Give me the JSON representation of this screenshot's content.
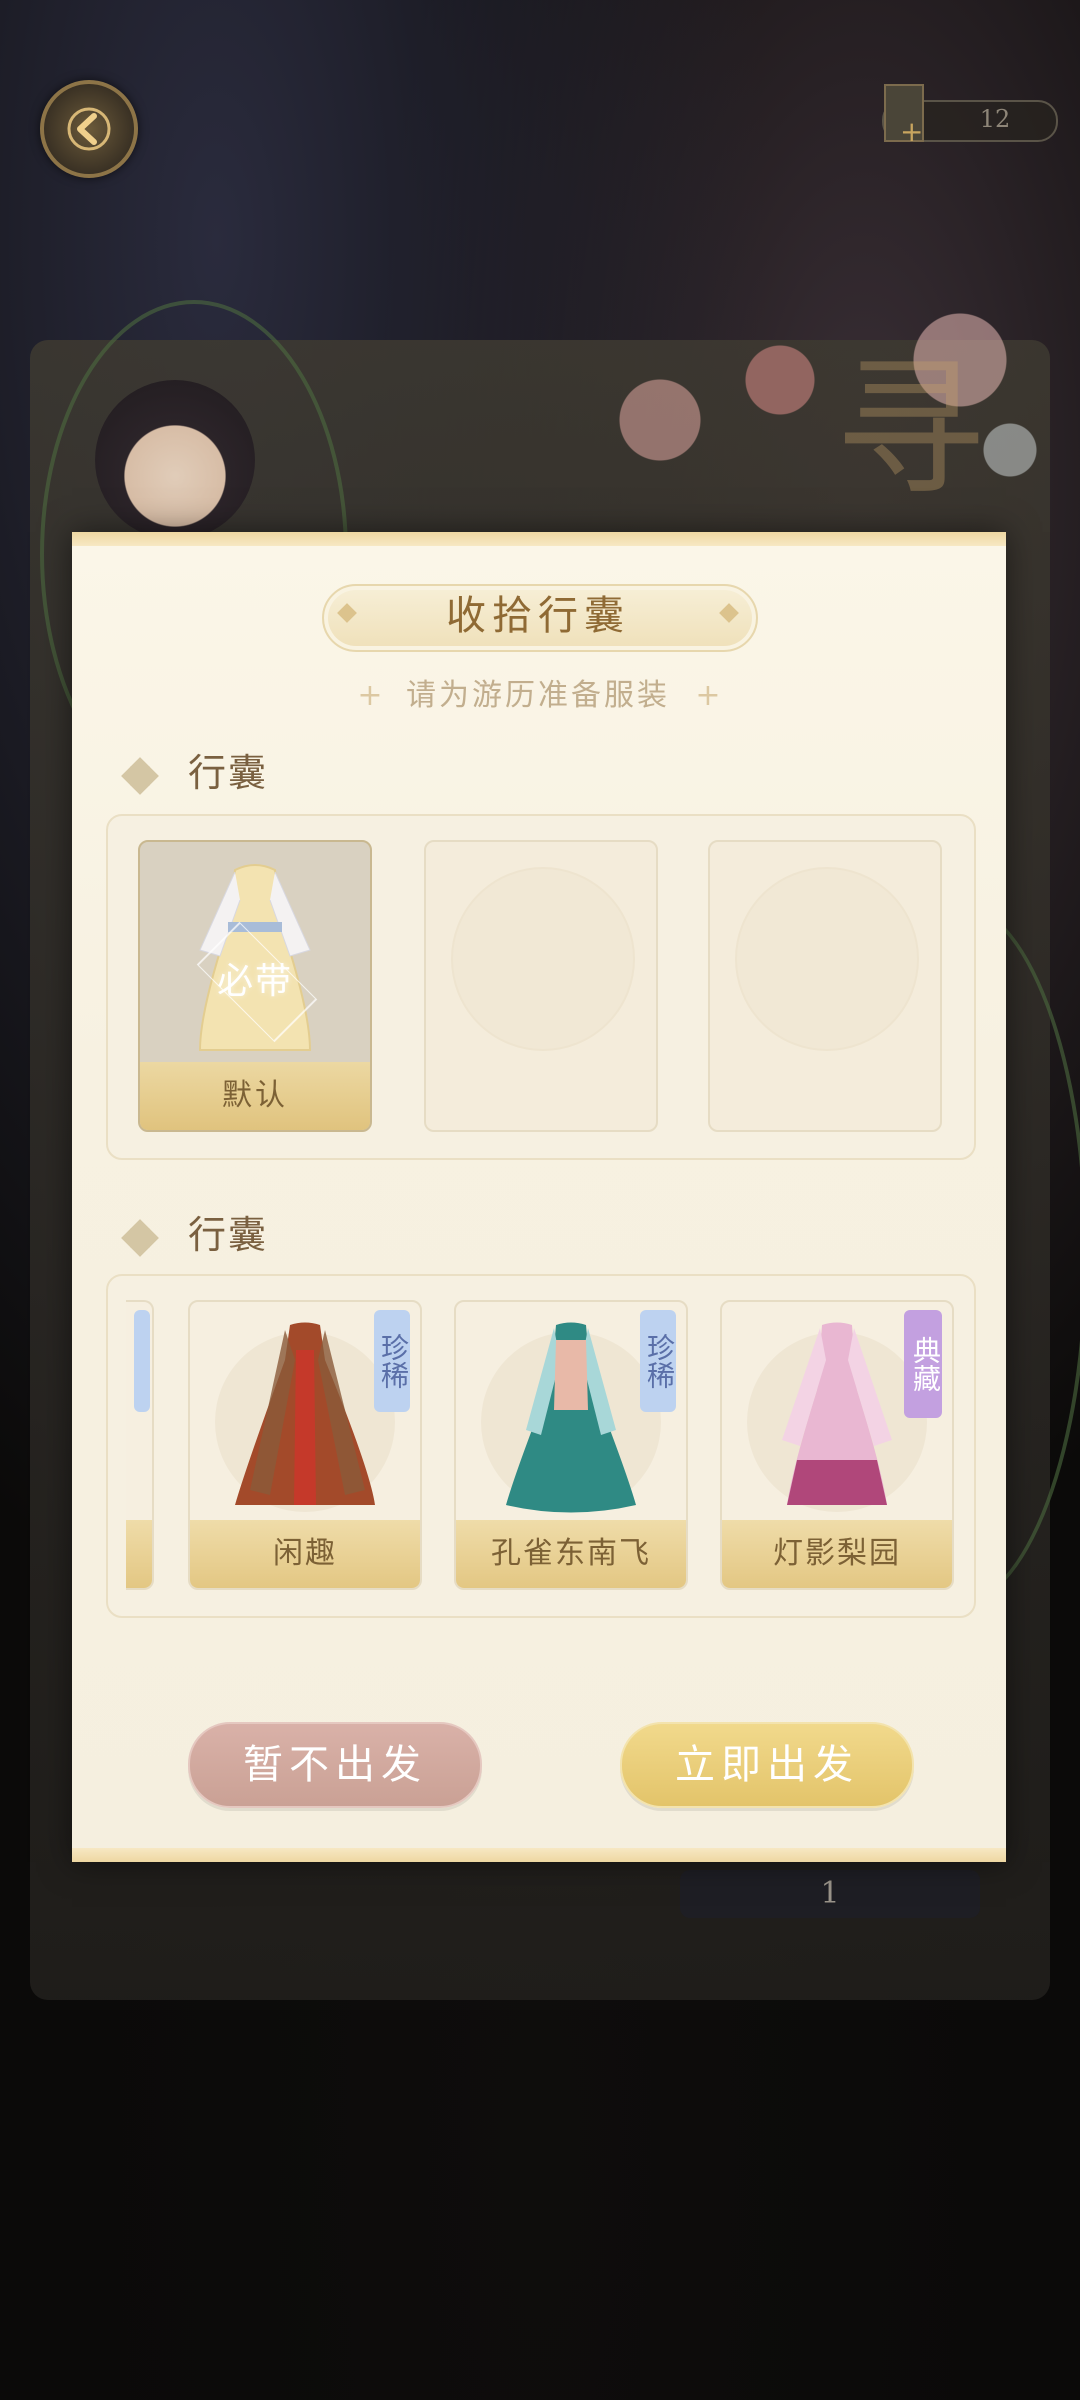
{
  "header": {
    "back_icon": "back-arrow-icon",
    "currency": {
      "icon": "coin-book-icon",
      "plus": "+",
      "value": "12"
    }
  },
  "modal": {
    "title": "收拾行囊",
    "subtitle": "请为游历准备服装",
    "subtitle_deco": "+",
    "packed_section": {
      "title": "行囊",
      "slots": [
        {
          "label": "默认",
          "badge": "必带",
          "filled": true
        },
        {
          "filled": false
        },
        {
          "filled": false
        }
      ]
    },
    "wardrobe_section": {
      "title": "行囊",
      "items": [
        {
          "rarity": "珍稀",
          "label": "",
          "partial": true
        },
        {
          "rarity": "珍稀",
          "label": "闲趣"
        },
        {
          "rarity": "珍稀",
          "label": "孔雀东南飞"
        },
        {
          "rarity": "典藏",
          "label": "灯影梨园"
        }
      ]
    },
    "buttons": {
      "cancel": "暂不出发",
      "confirm": "立即出发"
    }
  },
  "background": {
    "page_number": "1"
  },
  "colors": {
    "modal_bg": "#f7f1e1",
    "gold": "#e3c46a",
    "cancel_btn": "#caa195",
    "rarity_rare": "#bdd2f0",
    "rarity_collector": "#c3a0e0",
    "title_text": "#8f6a34"
  }
}
